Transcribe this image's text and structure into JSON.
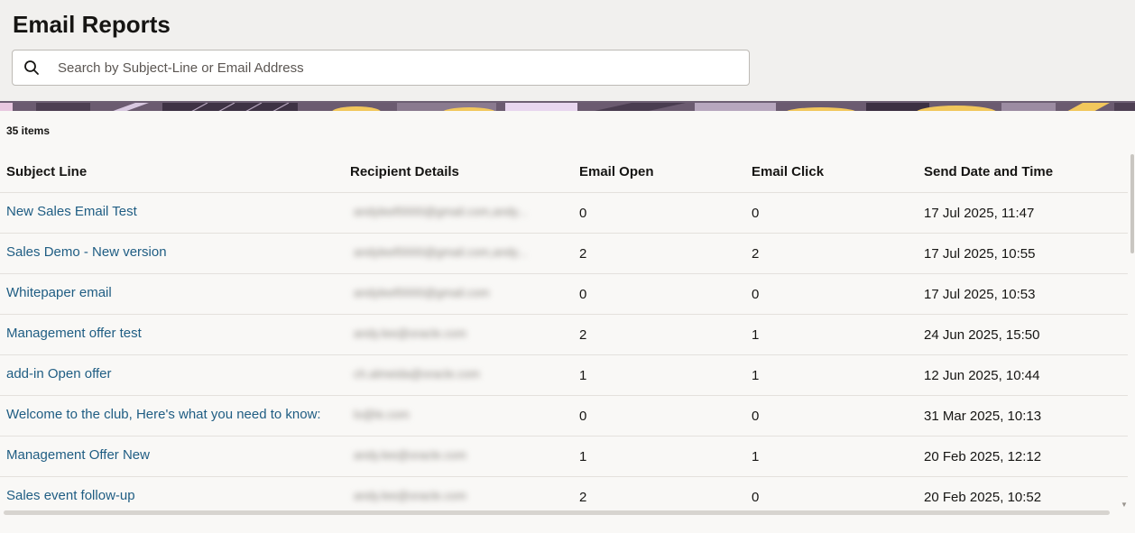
{
  "header": {
    "title": "Email Reports",
    "search": {
      "placeholder": "Search by Subject-Line or Email Address",
      "value": ""
    }
  },
  "table": {
    "items_count": "35 items",
    "columns": {
      "subject": "Subject Line",
      "recipient": "Recipient Details",
      "open": "Email Open",
      "click": "Email Click",
      "date": "Send Date and Time"
    },
    "rows": [
      {
        "subject": "New Sales Email Test",
        "recipient": "andyleef0000@gmail.com,andy...",
        "open": "0",
        "click": "0",
        "date": "17 Jul 2025, 11:47"
      },
      {
        "subject": "Sales Demo - New version",
        "recipient": "andyleef0000@gmail.com,andy...",
        "open": "2",
        "click": "2",
        "date": "17 Jul 2025, 10:55"
      },
      {
        "subject": "Whitepaper email",
        "recipient": "andyleef0000@gmail.com",
        "open": "0",
        "click": "0",
        "date": "17 Jul 2025, 10:53"
      },
      {
        "subject": "Management offer test",
        "recipient": "andy.lee@oracle.com",
        "open": "2",
        "click": "1",
        "date": "24 Jun 2025, 15:50"
      },
      {
        "subject": "add-in Open offer",
        "recipient": "ch.almeida@oracle.com",
        "open": "1",
        "click": "1",
        "date": "12 Jun 2025, 10:44"
      },
      {
        "subject": "Welcome to the club, Here's what you need to know:",
        "recipient": "lo@le.com",
        "open": "0",
        "click": "0",
        "date": "31 Mar 2025, 10:13"
      },
      {
        "subject": "Management Offer New",
        "recipient": "andy.lee@oracle.com",
        "open": "1",
        "click": "1",
        "date": "20 Feb 2025, 12:12"
      },
      {
        "subject": "Sales event follow-up",
        "recipient": "andy.lee@oracle.com",
        "open": "2",
        "click": "0",
        "date": "20 Feb 2025, 10:52"
      }
    ]
  },
  "colors": {
    "link": "#1f5d83",
    "header_bg": "#f1f0ee",
    "content_bg": "#f9f8f6"
  },
  "icons": {
    "search": "search-icon"
  }
}
